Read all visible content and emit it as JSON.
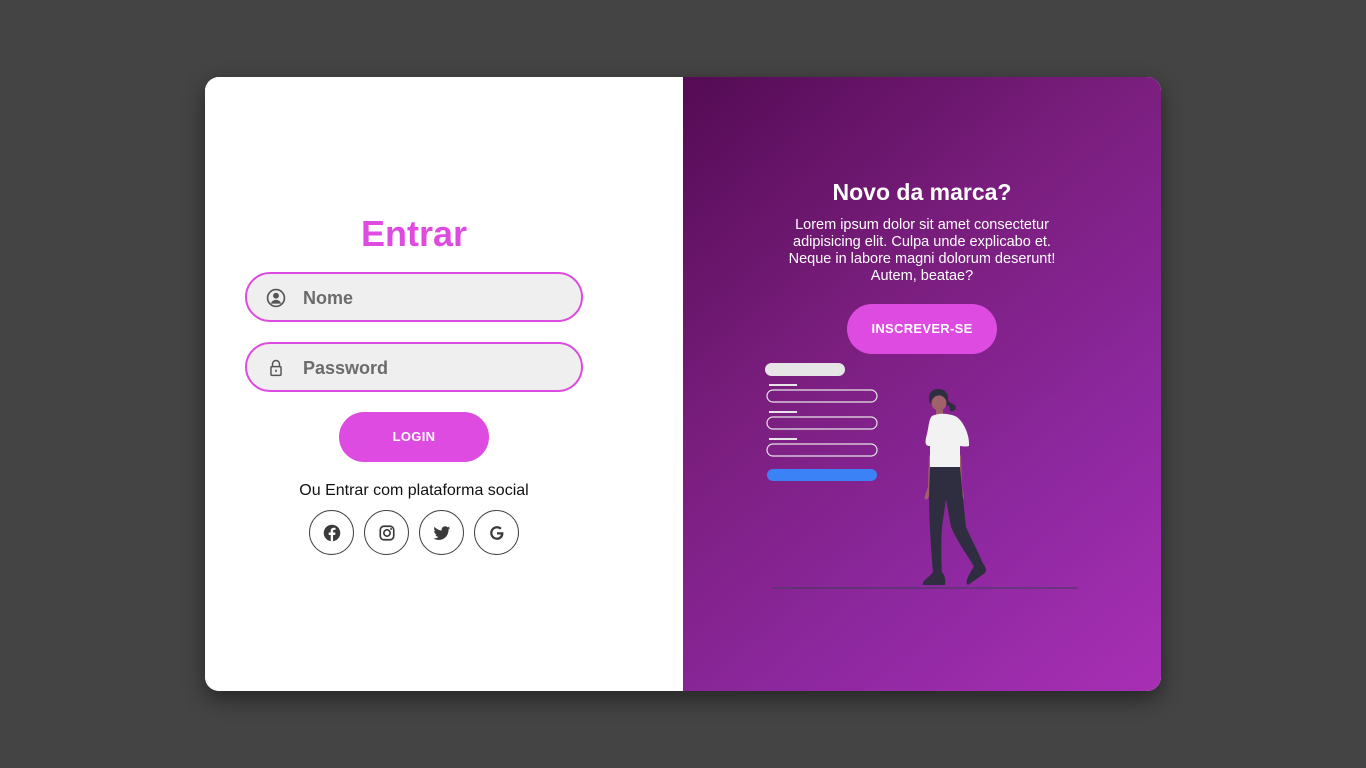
{
  "login": {
    "title": "Entrar",
    "username_placeholder": "Nome",
    "password_placeholder": "Password",
    "submit_label": "LOGIN",
    "social_text": "Ou Entrar com plataforma social",
    "social": [
      {
        "name": "Facebook",
        "icon": "facebook-icon"
      },
      {
        "name": "Instagram",
        "icon": "instagram-icon"
      },
      {
        "name": "Twitter",
        "icon": "twitter-icon"
      },
      {
        "name": "Google",
        "icon": "google-icon"
      }
    ]
  },
  "panel": {
    "title": "Novo da marca?",
    "text": "Lorem ipsum dolor sit amet consectetur adipisicing elit. Culpa unde explicabo et. Neque in labore magni dolorum deserunt! Autem, beatae?",
    "signup_label": "INSCREVER-SE",
    "illustration": "woman-with-form-illustration"
  },
  "colors": {
    "accent": "#dd4be0",
    "background": "#444444",
    "panel_gradient_start": "#540b54",
    "panel_gradient_end": "#a82fb4",
    "field_bg": "#efefef",
    "form_blue": "#3b82f6"
  }
}
